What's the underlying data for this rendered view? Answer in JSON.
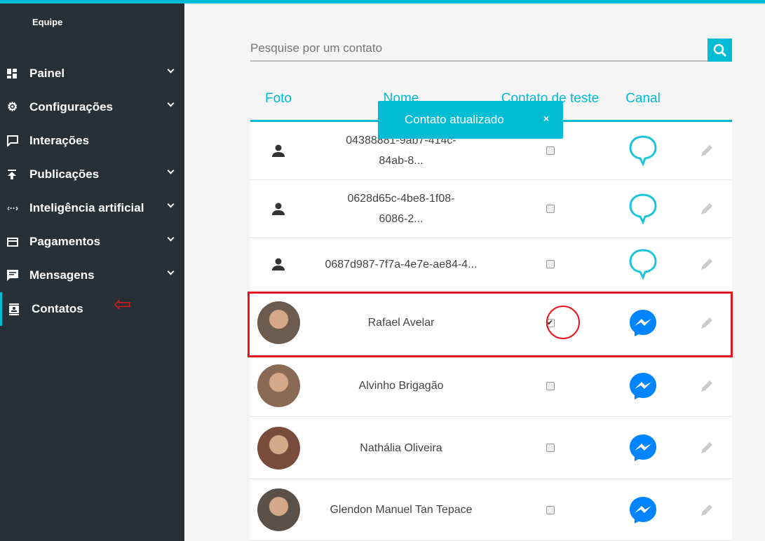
{
  "sidebar": {
    "team": "Equipe",
    "items": [
      {
        "label": "Painel",
        "icon": "dashboard-icon",
        "chevron": true
      },
      {
        "label": "Configurações",
        "icon": "gear-icon",
        "chevron": true
      },
      {
        "label": "Interações",
        "icon": "chat-icon",
        "chevron": false
      },
      {
        "label": "Publicações",
        "icon": "upload-icon",
        "chevron": true
      },
      {
        "label": "Inteligência artificial",
        "icon": "code-icon",
        "chevron": true
      },
      {
        "label": "Pagamentos",
        "icon": "credit-card-icon",
        "chevron": true
      },
      {
        "label": "Mensagens",
        "icon": "message-icon",
        "chevron": true
      },
      {
        "label": "Contatos",
        "icon": "contacts-icon",
        "chevron": false
      }
    ]
  },
  "search": {
    "placeholder": "Pesquise por um contato"
  },
  "table": {
    "headers": [
      "Foto",
      "Nome",
      "Contato de teste",
      "Canal"
    ],
    "rows": [
      {
        "name": "04388881-9ab7-414c-84ab-8...",
        "test": false,
        "channel": "chat"
      },
      {
        "name": "0628d65c-4be8-1f08-6086-2...",
        "test": false,
        "channel": "chat"
      },
      {
        "name": "0687d987-7f7a-4e7e-ae84-4...",
        "test": false,
        "channel": "chat"
      },
      {
        "name": "Rafael Avelar",
        "test": true,
        "channel": "messenger"
      },
      {
        "name": "Alvinho Brigagão",
        "test": false,
        "channel": "messenger"
      },
      {
        "name": "Nathália Oliveira",
        "test": false,
        "channel": "messenger"
      },
      {
        "name": "Glendon Manuel Tan Tepace",
        "test": false,
        "channel": "messenger"
      }
    ]
  },
  "toast": {
    "message": "Contato atualizado",
    "close": "×"
  },
  "colors": {
    "accent": "#00bcd4",
    "sidebar": "#283037",
    "messenger": "#0084ff",
    "highlight": "#e3161c"
  }
}
